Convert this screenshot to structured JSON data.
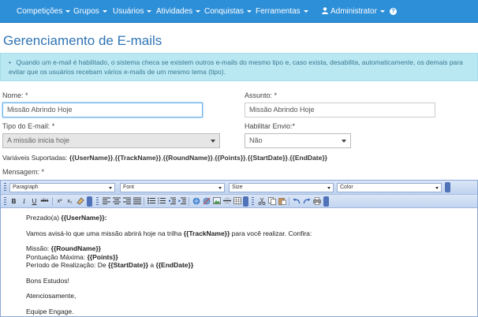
{
  "nav": {
    "items": [
      "Competições",
      "Grupos",
      "Usuários",
      "Atividades",
      "Conquistas",
      "Ferramentas"
    ],
    "user": "Administrator"
  },
  "page": {
    "title": "Gerenciamento de E-mails",
    "info": "Quando um e-mail é habilitado, o sistema checa se existem outros e-mails do mesmo tipo e, caso exista, desabilita, automaticamente, os demais para evitar que os usuários recebam vários e-mails de um mesmo tema (tipo).",
    "info_marker": "•"
  },
  "form": {
    "name_label": "Nome: *",
    "name_value": "Missão Abrindo Hoje",
    "subject_label": "Assunto: *",
    "subject_value": "Missão Abrindo Hoje",
    "type_label": "Tipo do E-mail: *",
    "type_value": "A missão inicia hoje",
    "enable_label": "Habilitar Envio:*",
    "enable_value": "Não",
    "vars_label": "Variáveis Suportadas:",
    "vars": [
      "{{UserName}}",
      "{{TrackName}}",
      "{{RoundName}}",
      "{{Points}}",
      "{{StartDate}}",
      "{{EndDate}}"
    ],
    "message_label": "Mensagem: *"
  },
  "editor": {
    "paragraph": "Paragraph",
    "font": "Font",
    "size": "Size",
    "color": "Color",
    "lines": {
      "greeting_pre": "Prezado(a) ",
      "greeting_var": "{{UserName}}",
      "greeting_post": ":",
      "intro_pre": "Vamos avisá-lo que uma missão abrirá hoje na trilha ",
      "intro_var": "{{TrackName}}",
      "intro_post": " para você realizar. Confira:",
      "mission_pre": "Missão: ",
      "mission_var": "{{RoundName}}",
      "points_pre": "Pontuação Máxima: ",
      "points_var": "{{Points}}",
      "period_pre": "Período de Realização: De ",
      "period_var1": "{{StartDate}}",
      "period_mid": " a ",
      "period_var2": "{{EndDate}}",
      "studies": "Bons Estudos!",
      "regards": "Atenciosamente,",
      "team": "Equipe Engage."
    }
  },
  "colors": {
    "navbar": "#2d8fd8",
    "title": "#2f74b5",
    "info_bg": "#b9e7f2"
  }
}
